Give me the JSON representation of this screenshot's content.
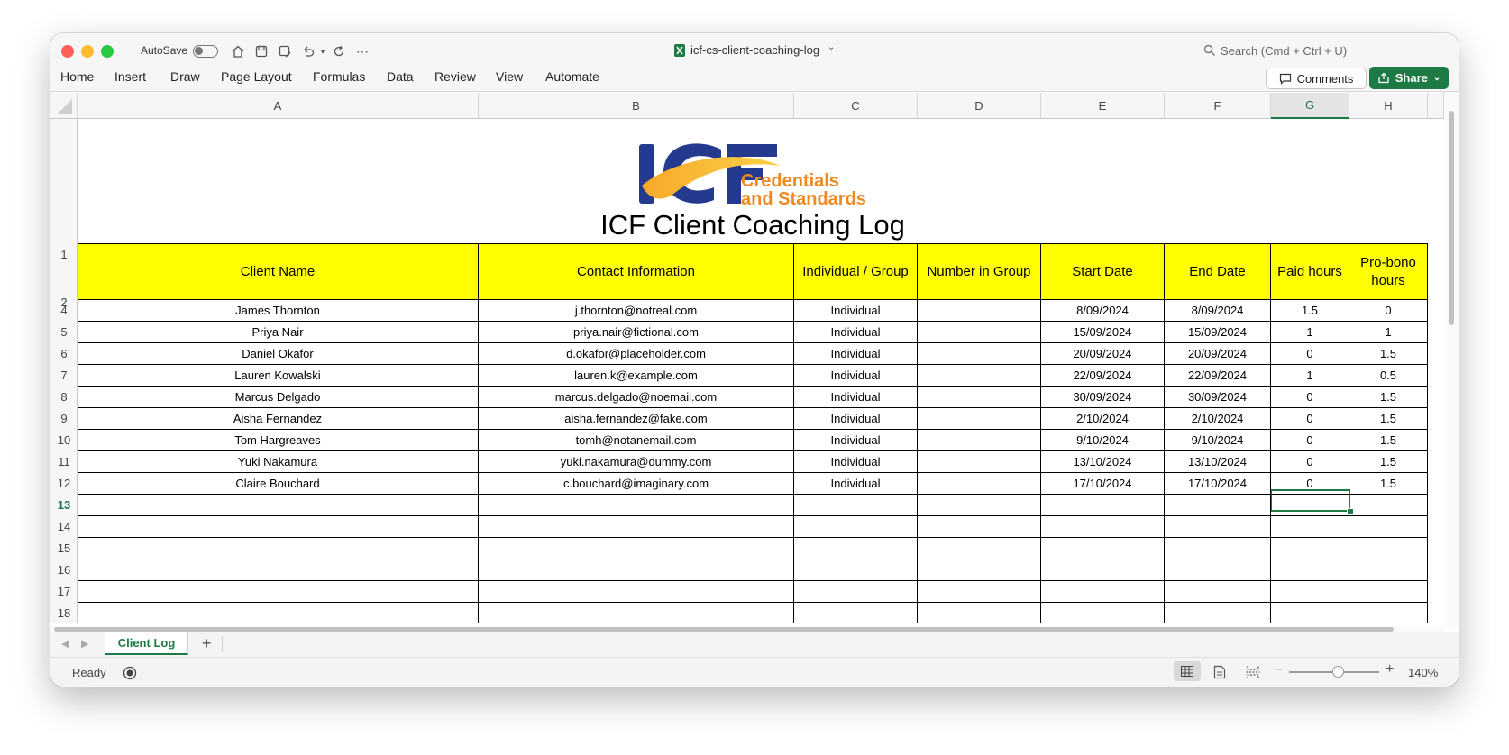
{
  "titlebar": {
    "autosave_label": "AutoSave",
    "filename": "icf-cs-client-coaching-log",
    "search_placeholder": "Search (Cmd + Ctrl + U)"
  },
  "ribbon": {
    "tabs": [
      "Home",
      "Insert",
      "Draw",
      "Page Layout",
      "Formulas",
      "Data",
      "Review",
      "View",
      "Automate"
    ],
    "comments_label": "Comments",
    "share_label": "Share"
  },
  "columns": [
    "A",
    "B",
    "C",
    "D",
    "E",
    "F",
    "G",
    "H"
  ],
  "selected_column": "G",
  "logo": {
    "mark": "ICF",
    "line1": "Credentials",
    "line2": "and Standards"
  },
  "sheet_title": "ICF Client Coaching Log",
  "headers": [
    "Client Name",
    "Contact Information",
    "Individual / Group",
    "Number in Group",
    "Start Date",
    "End Date",
    "Paid hours",
    "Pro-bono hours"
  ],
  "row_numbers": [
    "1",
    "2",
    "4",
    "5",
    "6",
    "7",
    "8",
    "9",
    "10",
    "11",
    "12",
    "13",
    "14",
    "15",
    "16",
    "17",
    "18"
  ],
  "selected_row": "13",
  "rows": [
    [
      "James Thornton",
      "j.thornton@notreal.com",
      "Individual",
      "",
      "8/09/2024",
      "8/09/2024",
      "1.5",
      "0"
    ],
    [
      "Priya Nair",
      "priya.nair@fictional.com",
      "Individual",
      "",
      "15/09/2024",
      "15/09/2024",
      "1",
      "1"
    ],
    [
      "Daniel Okafor",
      "d.okafor@placeholder.com",
      "Individual",
      "",
      "20/09/2024",
      "20/09/2024",
      "0",
      "1.5"
    ],
    [
      "Lauren Kowalski",
      "lauren.k@example.com",
      "Individual",
      "",
      "22/09/2024",
      "22/09/2024",
      "1",
      "0.5"
    ],
    [
      "Marcus Delgado",
      "marcus.delgado@noemail.com",
      "Individual",
      "",
      "30/09/2024",
      "30/09/2024",
      "0",
      "1.5"
    ],
    [
      "Aisha Fernandez",
      "aisha.fernandez@fake.com",
      "Individual",
      "",
      "2/10/2024",
      "2/10/2024",
      "0",
      "1.5"
    ],
    [
      "Tom Hargreaves",
      "tomh@notanemail.com",
      "Individual",
      "",
      "9/10/2024",
      "9/10/2024",
      "0",
      "1.5"
    ],
    [
      "Yuki Nakamura",
      "yuki.nakamura@dummy.com",
      "Individual",
      "",
      "13/10/2024",
      "13/10/2024",
      "0",
      "1.5"
    ],
    [
      "Claire Bouchard",
      "c.bouchard@imaginary.com",
      "Individual",
      "",
      "17/10/2024",
      "17/10/2024",
      "0",
      "1.5"
    ]
  ],
  "sheet_tabs": [
    "Client Log"
  ],
  "status": {
    "ready": "Ready",
    "zoom": "140%"
  },
  "colors": {
    "header_fill": "#ffff00",
    "accent_green": "#1d7a45",
    "logo_blue": "#243a8f",
    "logo_orange": "#ef8a22"
  }
}
